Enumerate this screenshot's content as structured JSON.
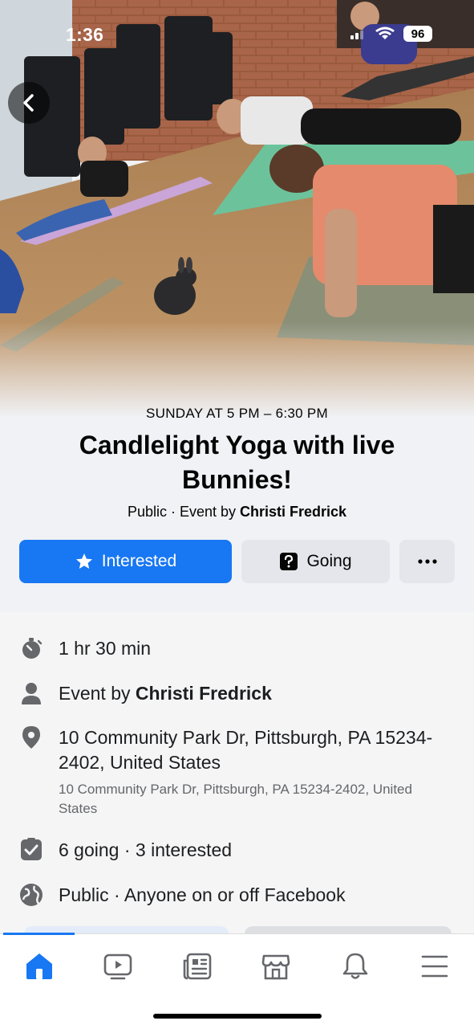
{
  "status_bar": {
    "time": "1:36",
    "battery": "96"
  },
  "event": {
    "datetime": "SUNDAY AT 5 PM – 6:30 PM",
    "title": "Candlelight Yoga with live Bunnies!",
    "privacy_prefix": "Public · Event by",
    "host": "Christi Fredrick"
  },
  "actions": {
    "interested_label": "Interested",
    "going_label": "Going",
    "more_label": "•••"
  },
  "details": {
    "duration": "1 hr 30 min",
    "host_prefix": "Event by",
    "host_name": "Christi Fredrick",
    "address": "10 Community Park Dr, Pittsburgh, PA 15234-2402, United States",
    "address_secondary": "10 Community Park Dr, Pittsburgh, PA 15234-2402, United States",
    "attendance": "6 going · 3 interested",
    "visibility": "Public · Anyone on or off Facebook"
  },
  "nav": {
    "items": [
      "home-icon",
      "video-icon",
      "news-icon",
      "marketplace-icon",
      "notifications-icon",
      "menu-icon"
    ],
    "active": "home-icon"
  },
  "colors": {
    "accent": "#1877f2",
    "background": "#f0f2f5",
    "secondary_button": "#e4e6eb"
  }
}
